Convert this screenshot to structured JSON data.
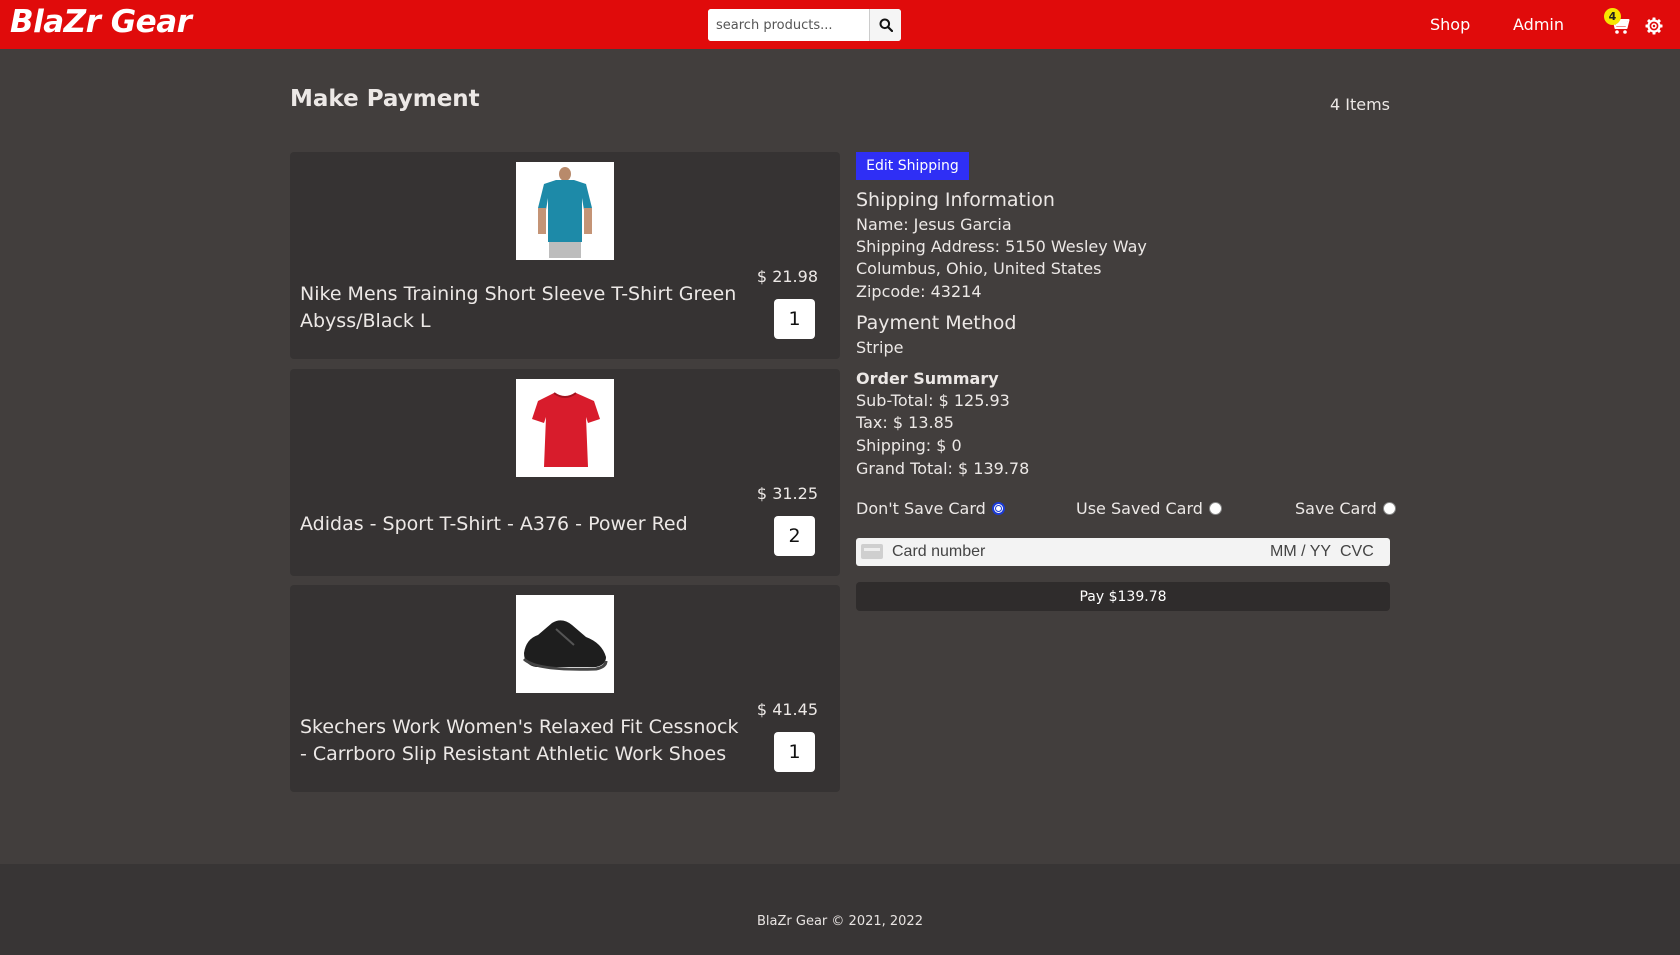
{
  "header": {
    "brand": "BlaZr Gear",
    "search_placeholder": "search products...",
    "nav": {
      "shop": "Shop",
      "admin": "Admin"
    },
    "cart_count": "4",
    "colors": {
      "bar": "#e00b0b",
      "badge": "#f7e500"
    }
  },
  "main": {
    "title": "Make Payment",
    "items_count": "4 Items",
    "products": [
      {
        "name": "Nike Mens Training Short Sleeve T-Shirt Green Abyss/Black L",
        "price": "$ 21.98",
        "qty": "1",
        "image": "teal-tshirt-photo"
      },
      {
        "name": "Adidas - Sport T-Shirt - A376 - Power Red",
        "price": "$ 31.25",
        "qty": "2",
        "image": "red-tshirt-photo"
      },
      {
        "name": "Skechers Work Women's Relaxed Fit Cessnock - Carrboro Slip Resistant Athletic Work Shoes",
        "price": "$ 41.45",
        "qty": "1",
        "image": "black-shoe-photo"
      }
    ]
  },
  "checkout": {
    "edit_shipping": "Edit Shipping",
    "shipping_heading": "Shipping Information",
    "name": "Name: Jesus Garcia",
    "address": "Shipping Address: 5150 Wesley Way",
    "city": "Columbus, Ohio, United States",
    "zip": "Zipcode: 43214",
    "payment_heading": "Payment Method",
    "payment_method": "Stripe",
    "summary_heading": "Order Summary",
    "subtotal": "Sub-Total: $ 125.93",
    "tax": "Tax: $ 13.85",
    "shipping": "Shipping: $ 0",
    "grand_total": "Grand Total: $ 139.78",
    "card_options": [
      {
        "label": "Don't Save Card",
        "selected": true
      },
      {
        "label": "Use Saved Card",
        "selected": false
      },
      {
        "label": "Save Card",
        "selected": false
      }
    ],
    "card_number_placeholder": "Card number",
    "card_exp_placeholder": "MM / YY",
    "card_cvc_placeholder": "CVC",
    "pay_button": "Pay $139.78",
    "colors": {
      "edit_button": "#2f2ff5"
    }
  },
  "footer": {
    "text": "BlaZr Gear © 2021, 2022"
  }
}
